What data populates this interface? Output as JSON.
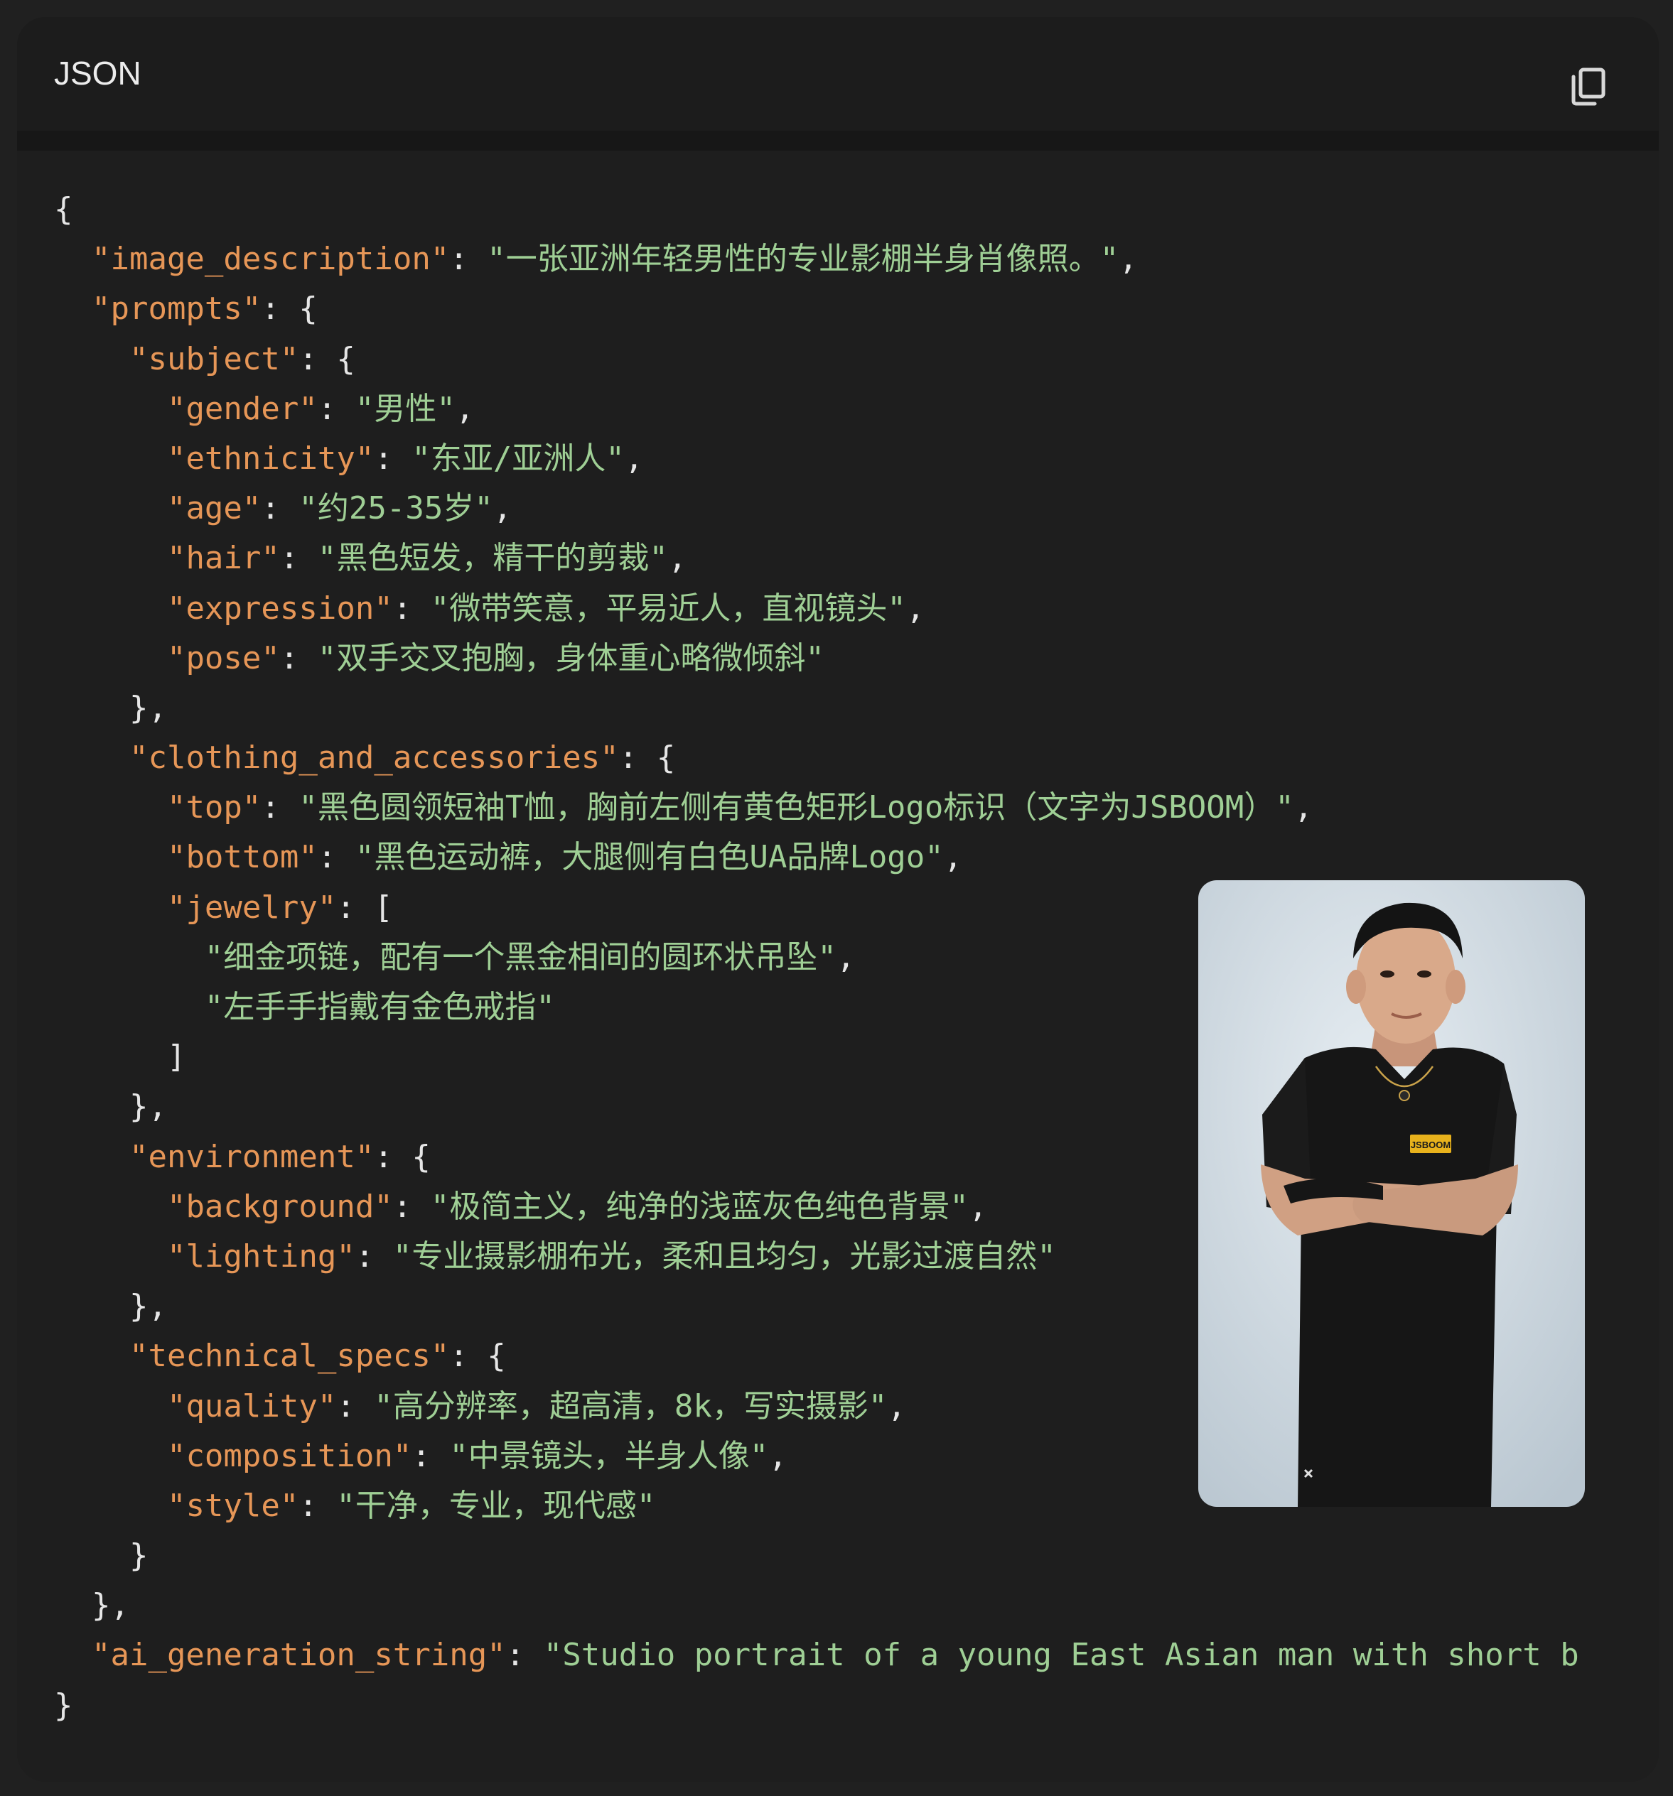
{
  "header": {
    "language": "JSON",
    "copy_icon": "copy-icon"
  },
  "code_lines": [
    [
      {
        "t": "p",
        "v": "{"
      }
    ],
    [
      {
        "t": "p",
        "v": "  "
      },
      {
        "t": "k",
        "v": "\"image_description\""
      },
      {
        "t": "p",
        "v": ": "
      },
      {
        "t": "s",
        "v": "\"一张亚洲年轻男性的专业影棚半身肖像照。\""
      },
      {
        "t": "p",
        "v": ","
      }
    ],
    [
      {
        "t": "p",
        "v": "  "
      },
      {
        "t": "k",
        "v": "\"prompts\""
      },
      {
        "t": "p",
        "v": ": {"
      }
    ],
    [
      {
        "t": "p",
        "v": "    "
      },
      {
        "t": "k",
        "v": "\"subject\""
      },
      {
        "t": "p",
        "v": ": {"
      }
    ],
    [
      {
        "t": "p",
        "v": "      "
      },
      {
        "t": "k",
        "v": "\"gender\""
      },
      {
        "t": "p",
        "v": ": "
      },
      {
        "t": "s",
        "v": "\"男性\""
      },
      {
        "t": "p",
        "v": ","
      }
    ],
    [
      {
        "t": "p",
        "v": "      "
      },
      {
        "t": "k",
        "v": "\"ethnicity\""
      },
      {
        "t": "p",
        "v": ": "
      },
      {
        "t": "s",
        "v": "\"东亚/亚洲人\""
      },
      {
        "t": "p",
        "v": ","
      }
    ],
    [
      {
        "t": "p",
        "v": "      "
      },
      {
        "t": "k",
        "v": "\"age\""
      },
      {
        "t": "p",
        "v": ": "
      },
      {
        "t": "s",
        "v": "\"约25-35岁\""
      },
      {
        "t": "p",
        "v": ","
      }
    ],
    [
      {
        "t": "p",
        "v": "      "
      },
      {
        "t": "k",
        "v": "\"hair\""
      },
      {
        "t": "p",
        "v": ": "
      },
      {
        "t": "s",
        "v": "\"黑色短发，精干的剪裁\""
      },
      {
        "t": "p",
        "v": ","
      }
    ],
    [
      {
        "t": "p",
        "v": "      "
      },
      {
        "t": "k",
        "v": "\"expression\""
      },
      {
        "t": "p",
        "v": ": "
      },
      {
        "t": "s",
        "v": "\"微带笑意，平易近人，直视镜头\""
      },
      {
        "t": "p",
        "v": ","
      }
    ],
    [
      {
        "t": "p",
        "v": "      "
      },
      {
        "t": "k",
        "v": "\"pose\""
      },
      {
        "t": "p",
        "v": ": "
      },
      {
        "t": "s",
        "v": "\"双手交叉抱胸，身体重心略微倾斜\""
      }
    ],
    [
      {
        "t": "p",
        "v": "    },"
      }
    ],
    [
      {
        "t": "p",
        "v": "    "
      },
      {
        "t": "k",
        "v": "\"clothing_and_accessories\""
      },
      {
        "t": "p",
        "v": ": {"
      }
    ],
    [
      {
        "t": "p",
        "v": "      "
      },
      {
        "t": "k",
        "v": "\"top\""
      },
      {
        "t": "p",
        "v": ": "
      },
      {
        "t": "s",
        "v": "\"黑色圆领短袖T恤，胸前左侧有黄色矩形Logo标识（文字为JSBOOM）\""
      },
      {
        "t": "p",
        "v": ","
      }
    ],
    [
      {
        "t": "p",
        "v": "      "
      },
      {
        "t": "k",
        "v": "\"bottom\""
      },
      {
        "t": "p",
        "v": ": "
      },
      {
        "t": "s",
        "v": "\"黑色运动裤，大腿侧有白色UA品牌Logo\""
      },
      {
        "t": "p",
        "v": ","
      }
    ],
    [
      {
        "t": "p",
        "v": "      "
      },
      {
        "t": "k",
        "v": "\"jewelry\""
      },
      {
        "t": "p",
        "v": ": ["
      }
    ],
    [
      {
        "t": "p",
        "v": "        "
      },
      {
        "t": "s",
        "v": "\"细金项链，配有一个黑金相间的圆环状吊坠\""
      },
      {
        "t": "p",
        "v": ","
      }
    ],
    [
      {
        "t": "p",
        "v": "        "
      },
      {
        "t": "s",
        "v": "\"左手手指戴有金色戒指\""
      }
    ],
    [
      {
        "t": "p",
        "v": "      ]"
      }
    ],
    [
      {
        "t": "p",
        "v": "    },"
      }
    ],
    [
      {
        "t": "p",
        "v": "    "
      },
      {
        "t": "k",
        "v": "\"environment\""
      },
      {
        "t": "p",
        "v": ": {"
      }
    ],
    [
      {
        "t": "p",
        "v": "      "
      },
      {
        "t": "k",
        "v": "\"background\""
      },
      {
        "t": "p",
        "v": ": "
      },
      {
        "t": "s",
        "v": "\"极简主义，纯净的浅蓝灰色纯色背景\""
      },
      {
        "t": "p",
        "v": ","
      }
    ],
    [
      {
        "t": "p",
        "v": "      "
      },
      {
        "t": "k",
        "v": "\"lighting\""
      },
      {
        "t": "p",
        "v": ": "
      },
      {
        "t": "s",
        "v": "\"专业摄影棚布光，柔和且均匀，光影过渡自然\""
      }
    ],
    [
      {
        "t": "p",
        "v": "    },"
      }
    ],
    [
      {
        "t": "p",
        "v": "    "
      },
      {
        "t": "k",
        "v": "\"technical_specs\""
      },
      {
        "t": "p",
        "v": ": {"
      }
    ],
    [
      {
        "t": "p",
        "v": "      "
      },
      {
        "t": "k",
        "v": "\"quality\""
      },
      {
        "t": "p",
        "v": ": "
      },
      {
        "t": "s",
        "v": "\"高分辨率，超高清，8k，写实摄影\""
      },
      {
        "t": "p",
        "v": ","
      }
    ],
    [
      {
        "t": "p",
        "v": "      "
      },
      {
        "t": "k",
        "v": "\"composition\""
      },
      {
        "t": "p",
        "v": ": "
      },
      {
        "t": "s",
        "v": "\"中景镜头，半身人像\""
      },
      {
        "t": "p",
        "v": ","
      }
    ],
    [
      {
        "t": "p",
        "v": "      "
      },
      {
        "t": "k",
        "v": "\"style\""
      },
      {
        "t": "p",
        "v": ": "
      },
      {
        "t": "s",
        "v": "\"干净，专业，现代感\""
      }
    ],
    [
      {
        "t": "p",
        "v": "    }"
      }
    ],
    [
      {
        "t": "p",
        "v": "  },"
      }
    ],
    [
      {
        "t": "p",
        "v": "  "
      },
      {
        "t": "k",
        "v": "\"ai_generation_string\""
      },
      {
        "t": "p",
        "v": ": "
      },
      {
        "t": "s",
        "v": "\"Studio portrait of a young East Asian man with short b"
      }
    ],
    [
      {
        "t": "p",
        "v": "}"
      }
    ]
  ],
  "photo": {
    "logo_text": "JSBOOM",
    "colors": {
      "background": "#cfd9e1",
      "shirt": "#161616",
      "skin": "#d9a98a",
      "hair": "#141414",
      "logo": "#e8b21c"
    }
  },
  "colors": {
    "key": "#e69657",
    "string": "#9fcf95",
    "punctuation": "#e6e6e6",
    "panel": "#1e1e1e",
    "header": "#1c1c1c"
  }
}
